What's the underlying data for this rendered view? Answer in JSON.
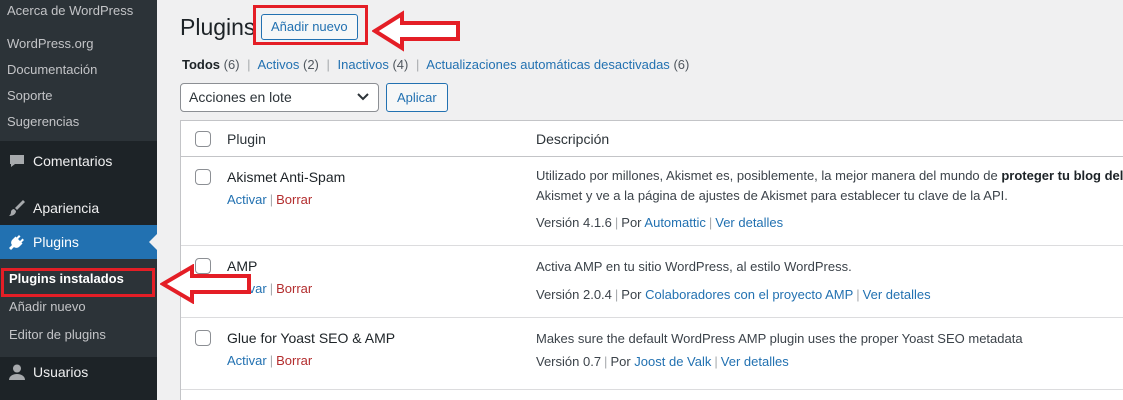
{
  "sidebar": {
    "top_items": [
      "Acerca de WordPress"
    ],
    "links": [
      "WordPress.org",
      "Documentación",
      "Soporte",
      "Sugerencias"
    ],
    "menu": {
      "comments": "Comentarios",
      "appearance": "Apariencia",
      "plugins": "Plugins",
      "users": "Usuarios"
    },
    "plugins_sub": [
      "Plugins instalados",
      "Añadir nuevo",
      "Editor de plugins"
    ]
  },
  "header": {
    "title": "Plugins",
    "add_new": "Añadir nuevo"
  },
  "filters": {
    "all": "Todos",
    "all_count": "(6)",
    "active": "Activos",
    "active_count": "(2)",
    "inactive": "Inactivos",
    "inactive_count": "(4)",
    "auto_off": "Actualizaciones automáticas desactivadas",
    "auto_off_count": "(6)"
  },
  "bulk": {
    "selected": "Acciones en lote",
    "apply": "Aplicar"
  },
  "table": {
    "col_plugin": "Plugin",
    "col_desc": "Descripción",
    "rows": [
      {
        "name": "Akismet Anti-Spam",
        "activate": "Activar",
        "delete": "Borrar",
        "desc_1": "Utilizado por millones, Akismet es, posiblemente, la mejor manera del mundo de ",
        "desc_bold": "proteger tu blog del s",
        "desc_2": "Akismet y ve a la página de ajustes de Akismet para establecer tu clave de la API.",
        "version": "Versión 4.1.6",
        "by": "Por",
        "author": "Automattic",
        "details": "Ver detalles"
      },
      {
        "name": "AMP",
        "activate": "Activar",
        "delete": "Borrar",
        "desc_1": "Activa AMP en tu sitio WordPress, al estilo WordPress.",
        "version": "Versión 2.0.4",
        "by": "Por",
        "author": "Colaboradores con el proyecto AMP",
        "details": "Ver detalles"
      },
      {
        "name": "Glue for Yoast SEO & AMP",
        "activate": "Activar",
        "delete": "Borrar",
        "desc_1": "Makes sure the default WordPress AMP plugin uses the proper Yoast SEO metadata",
        "version": "Versión 0.7",
        "by": "Por",
        "author": "Joost de Valk",
        "details": "Ver detalles"
      }
    ]
  },
  "colors": {
    "sidebar_bg": "#1d2327",
    "accent": "#2271b1",
    "annotation": "#e41e26"
  }
}
